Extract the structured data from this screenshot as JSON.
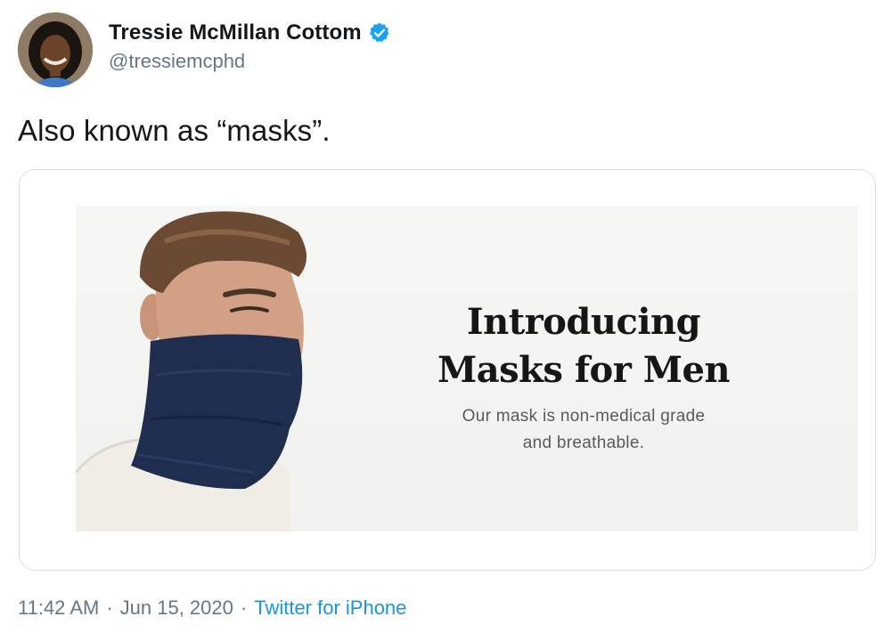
{
  "tweet": {
    "author": {
      "display_name": "Tressie McMillan Cottom",
      "handle": "@tressiemcphd",
      "verified": true,
      "avatar_icon": "profile-photo",
      "verified_icon": "verified-badge-icon"
    },
    "text": "Also known as “masks”.",
    "media": {
      "headline_line1": "Introducing",
      "headline_line2": "Masks for Men",
      "subtext_line1": "Our mask is non-medical grade",
      "subtext_line2": "and breathable.",
      "mask_color": "#1f2e4e"
    },
    "meta": {
      "time": "11:42 AM",
      "separator": "·",
      "date": "Jun 15, 2020",
      "source": "Twitter for iPhone"
    }
  },
  "colors": {
    "link_blue": "#1b95e0",
    "secondary_text": "#657786",
    "primary_text": "#14171a",
    "verified_blue": "#1da1f2"
  }
}
